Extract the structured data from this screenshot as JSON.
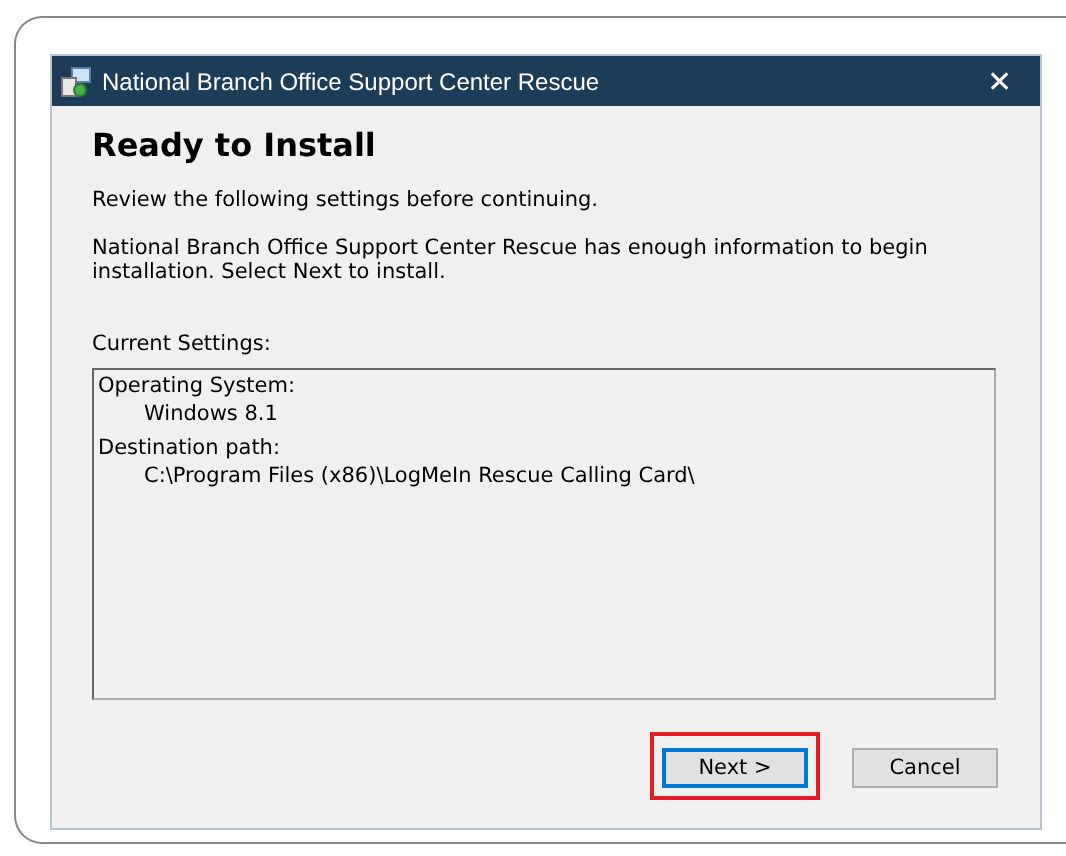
{
  "window": {
    "title": "National Branch Office Support Center Rescue",
    "close": "✕"
  },
  "heading": "Ready to Install",
  "paragraphs": [
    "Review the following settings before continuing.",
    "National Branch Office Support Center Rescue has enough information to begin installation. Select Next to install."
  ],
  "settings_label": "Current Settings:",
  "settings": [
    {
      "label": "Operating System:",
      "value": "Windows 8.1"
    },
    {
      "label": "Destination path:",
      "value": "C:\\Program Files (x86)\\LogMeIn Rescue Calling Card\\"
    }
  ],
  "buttons": [
    {
      "label": "Next >",
      "focused": true,
      "highlighted": true
    },
    {
      "label": "Cancel",
      "focused": false,
      "highlighted": false
    }
  ]
}
